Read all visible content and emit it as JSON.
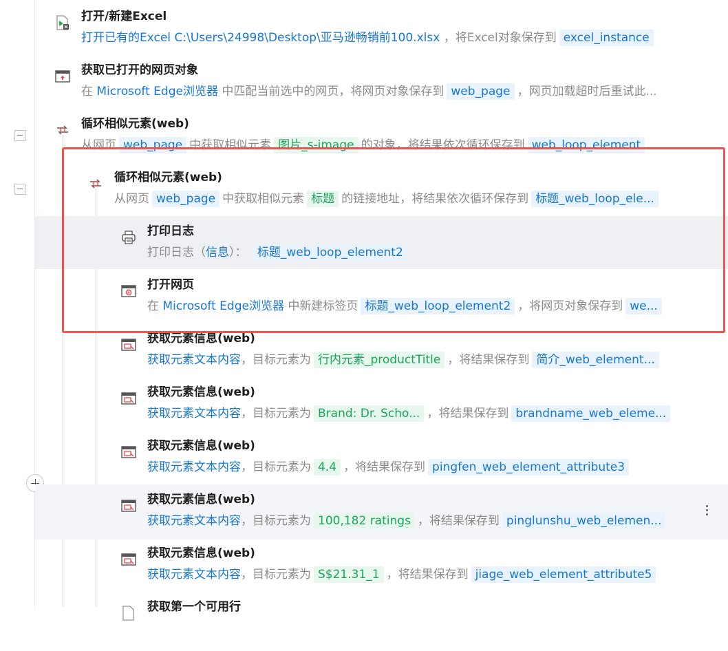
{
  "steps": [
    {
      "title": "打开/新建Excel",
      "icon": "excel-icon",
      "desc": [
        {
          "k": "b",
          "t": "打开已有的Excel "
        },
        {
          "k": "b",
          "t": " C:\\Users\\24998\\Desktop\\亚马逊畅销前100.xlsx "
        },
        {
          "k": "t",
          "t": "，将Excel对象保存到"
        },
        {
          "k": "chip-b",
          "t": "excel_instance"
        }
      ]
    },
    {
      "title": "获取已打开的网页对象",
      "icon": "browser-icon",
      "desc": [
        {
          "k": "t",
          "t": "在 "
        },
        {
          "k": "b",
          "t": "Microsoft Edge浏览器"
        },
        {
          "k": "t",
          "t": " 中匹配当前选中的网页，将网页对象保存到"
        },
        {
          "k": "chip-b",
          "t": "web_page"
        },
        {
          "k": "t",
          "t": "，网页加载超时后重试此..."
        }
      ]
    },
    {
      "title": "循环相似元素(web)",
      "icon": "loop-icon",
      "desc": [
        {
          "k": "t",
          "t": "从网页"
        },
        {
          "k": "chip-b",
          "t": "web_page"
        },
        {
          "k": "t",
          "t": "中获取相似元素"
        },
        {
          "k": "chip-g",
          "t": "图片_s-image"
        },
        {
          "k": "t",
          "t": "的对象，将结果依次循环保存到"
        },
        {
          "k": "chip-b",
          "t": "web_loop_element"
        }
      ]
    },
    {
      "title": "循环相似元素(web)",
      "icon": "loop-icon",
      "desc": [
        {
          "k": "t",
          "t": "从网页"
        },
        {
          "k": "chip-b",
          "t": "web_page"
        },
        {
          "k": "t",
          "t": "中获取相似元素"
        },
        {
          "k": "chip-g",
          "t": "标题"
        },
        {
          "k": "t",
          "t": "的链接地址，将结果依次循环保存到"
        },
        {
          "k": "chip-b",
          "t": "标题_web_loop_ele..."
        }
      ]
    },
    {
      "title": "打印日志",
      "icon": "printer-icon",
      "desc": [
        {
          "k": "t",
          "t": "打印日志（"
        },
        {
          "k": "b",
          "t": "信息"
        },
        {
          "k": "t",
          "t": "）： "
        },
        {
          "k": "chip-b",
          "t": "标题_web_loop_element2"
        }
      ]
    },
    {
      "title": "打开网页",
      "icon": "open-webpage-icon",
      "desc": [
        {
          "k": "t",
          "t": "在 "
        },
        {
          "k": "b",
          "t": "Microsoft Edge浏览器"
        },
        {
          "k": "t",
          "t": " 中新建标签页"
        },
        {
          "k": "chip-b",
          "t": "标题_web_loop_element2"
        },
        {
          "k": "t",
          "t": "，将网页对象保存到"
        },
        {
          "k": "chip-b",
          "t": "we..."
        }
      ]
    },
    {
      "title": "获取元素信息(web)",
      "icon": "element-info-icon",
      "desc": [
        {
          "k": "b",
          "t": "获取元素文本内容"
        },
        {
          "k": "t",
          "t": "，目标元素为"
        },
        {
          "k": "chip-g",
          "t": "行内元素_productTitle"
        },
        {
          "k": "t",
          "t": "，将结果保存到"
        },
        {
          "k": "chip-b",
          "t": "简介_web_element..."
        }
      ]
    },
    {
      "title": "获取元素信息(web)",
      "icon": "element-info-icon",
      "desc": [
        {
          "k": "b",
          "t": "获取元素文本内容"
        },
        {
          "k": "t",
          "t": "，目标元素为"
        },
        {
          "k": "chip-g",
          "t": "Brand: Dr. Scho..."
        },
        {
          "k": "t",
          "t": "，将结果保存到"
        },
        {
          "k": "chip-b",
          "t": "brandname_web_eleme..."
        }
      ]
    },
    {
      "title": "获取元素信息(web)",
      "icon": "element-info-icon",
      "desc": [
        {
          "k": "b",
          "t": "获取元素文本内容"
        },
        {
          "k": "t",
          "t": "，目标元素为"
        },
        {
          "k": "chip-g",
          "t": "4.4"
        },
        {
          "k": "t",
          "t": "，将结果保存到"
        },
        {
          "k": "chip-b",
          "t": "pingfen_web_element_attribute3"
        }
      ]
    },
    {
      "title": "获取元素信息(web)",
      "icon": "element-info-icon",
      "desc": [
        {
          "k": "b",
          "t": "获取元素文本内容"
        },
        {
          "k": "t",
          "t": "，目标元素为"
        },
        {
          "k": "chip-g",
          "t": "100,182 ratings"
        },
        {
          "k": "t",
          "t": "，将结果保存到"
        },
        {
          "k": "chip-b",
          "t": "pinglunshu_web_elemen..."
        }
      ]
    },
    {
      "title": "获取元素信息(web)",
      "icon": "element-info-icon",
      "desc": [
        {
          "k": "b",
          "t": "获取元素文本内容"
        },
        {
          "k": "t",
          "t": "，目标元素为"
        },
        {
          "k": "chip-g",
          "t": "S$21.31_1"
        },
        {
          "k": "t",
          "t": "，将结果保存到"
        },
        {
          "k": "chip-b",
          "t": "jiage_web_element_attribute5"
        }
      ]
    },
    {
      "title": "获取第一个可用行",
      "icon": "excel-row-icon",
      "desc": []
    }
  ],
  "colors": {
    "link": "#1677d2",
    "green": "#1aa55a",
    "highlight": "#f0544f"
  }
}
